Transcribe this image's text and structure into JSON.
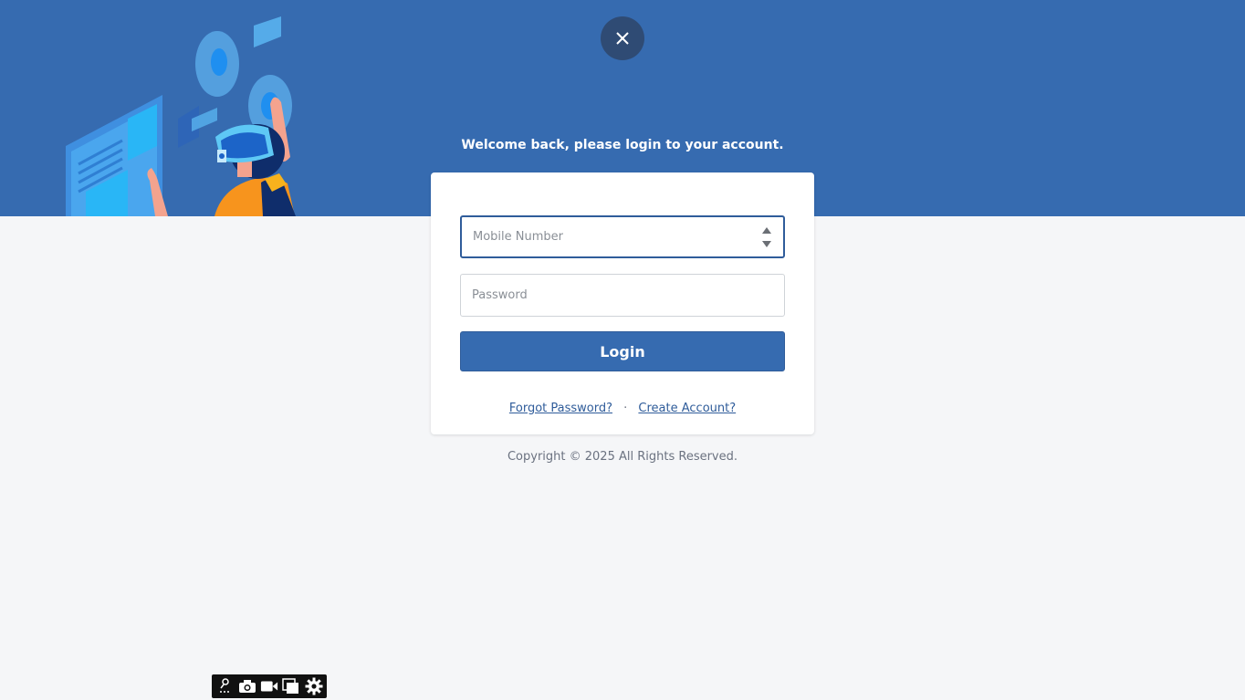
{
  "header": {
    "welcome_text": "Welcome back, please login to your account.",
    "close_icon": "close-icon",
    "background_color": "#366bb0"
  },
  "form": {
    "mobile_placeholder": "Mobile Number",
    "mobile_value": "",
    "password_placeholder": "Password",
    "password_value": "",
    "login_label": "Login",
    "forgot_label": "Forgot Password?",
    "separator": "·",
    "create_label": "Create Account?"
  },
  "footer": {
    "copyright": "Copyright © 2025 All Rights Reserved."
  },
  "toolbar": {
    "icons": [
      "pin-icon",
      "camera-icon",
      "video-icon",
      "windows-icon",
      "gear-icon"
    ]
  },
  "colors": {
    "accent": "#366bb0",
    "link": "#2f5c9a",
    "page_bg": "#f5f6f8"
  }
}
